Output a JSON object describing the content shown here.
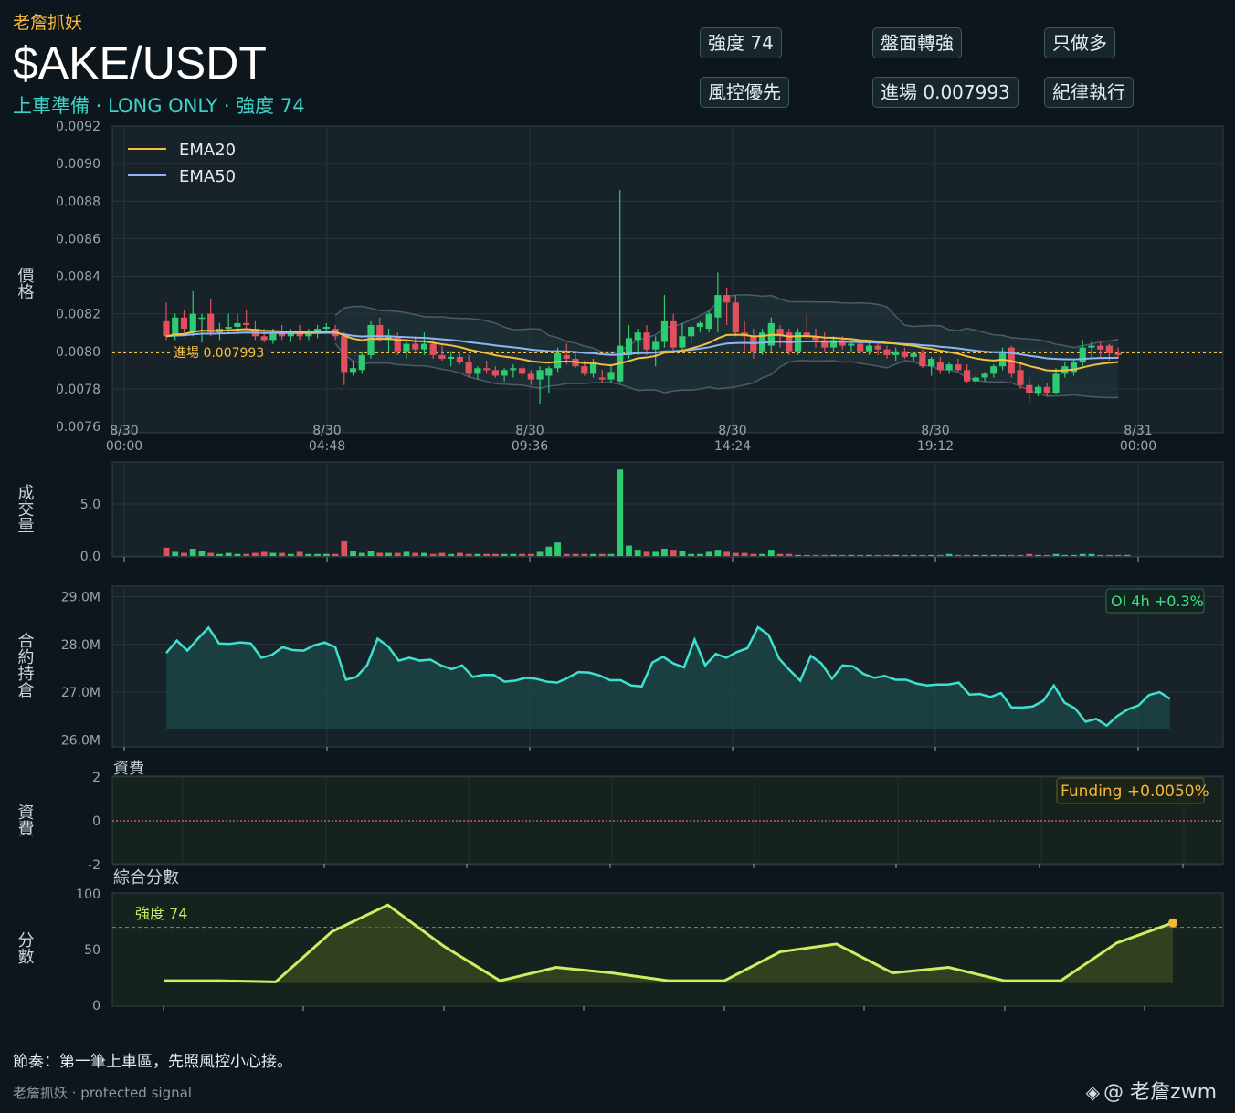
{
  "header": {
    "brand": "老詹抓妖",
    "pair": "$AKE/USDT",
    "subtitle": "上車準備 · LONG ONLY · 強度 74"
  },
  "tags": [
    {
      "label": "強度 74"
    },
    {
      "label": "盤面轉強"
    },
    {
      "label": "只做多"
    },
    {
      "label": "風控優先"
    },
    {
      "label": "進場 0.007993"
    },
    {
      "label": "紀律執行"
    }
  ],
  "footer": {
    "note": "節奏：第一筆上車區，先照風控小心接。",
    "credit": "老詹抓妖 · protected signal",
    "watermark": "@ 老詹zwm"
  },
  "colors": {
    "background": "#0d161c",
    "panel": "#172329",
    "up": "#2ecc71",
    "down": "#e0515d",
    "ema20": "#f0c040",
    "ema50": "#8fb5f5",
    "oi": "#3ee0d0",
    "score": "#c8f060",
    "entry": "#f5c542",
    "funding": "#f5b73a"
  },
  "chart_data": [
    {
      "type": "candlestick",
      "ylabel": "價格",
      "ylim": [
        0.0076,
        0.0092
      ],
      "yticks": [
        "0.0076",
        "0.0078",
        "0.0080",
        "0.0082",
        "0.0084",
        "0.0086",
        "0.0088",
        "0.0090",
        "0.0092"
      ],
      "xticks": [
        "8/30\n00:00",
        "8/30\n04:48",
        "8/30\n09:36",
        "8/30\n14:24",
        "8/30\n19:12",
        "8/31\n00:00"
      ],
      "legend": {
        "position": "top-left",
        "entries": [
          "EMA20",
          "EMA50"
        ]
      },
      "entry_line": {
        "value": 0.007993,
        "label": "進場 0.007993"
      },
      "ohlc": [
        [
          0.00816,
          0.00826,
          0.00806,
          0.00808
        ],
        [
          0.00808,
          0.0082,
          0.00806,
          0.00818
        ],
        [
          0.00818,
          0.00822,
          0.0081,
          0.00812
        ],
        [
          0.0081,
          0.00832,
          0.00808,
          0.0082
        ],
        [
          0.00818,
          0.0082,
          0.00804,
          0.00818
        ],
        [
          0.0082,
          0.00828,
          0.00808,
          0.0081
        ],
        [
          0.0081,
          0.00815,
          0.00806,
          0.00812
        ],
        [
          0.00812,
          0.0082,
          0.0081,
          0.00813
        ],
        [
          0.00813,
          0.0082,
          0.0081,
          0.00815
        ],
        [
          0.00815,
          0.00822,
          0.00812,
          0.00814
        ],
        [
          0.00812,
          0.00816,
          0.00806,
          0.00808
        ],
        [
          0.00808,
          0.00812,
          0.00804,
          0.00806
        ],
        [
          0.00806,
          0.00812,
          0.00804,
          0.0081
        ],
        [
          0.0081,
          0.00814,
          0.00806,
          0.00808
        ],
        [
          0.00808,
          0.00812,
          0.00805,
          0.0081
        ],
        [
          0.0081,
          0.00814,
          0.00806,
          0.00808
        ],
        [
          0.00808,
          0.00812,
          0.00806,
          0.0081
        ],
        [
          0.0081,
          0.00814,
          0.00807,
          0.00812
        ],
        [
          0.00812,
          0.00815,
          0.0081,
          0.00813
        ],
        [
          0.00812,
          0.00814,
          0.00806,
          0.00808
        ],
        [
          0.00808,
          0.0081,
          0.00782,
          0.00789
        ],
        [
          0.00789,
          0.00795,
          0.00787,
          0.00791
        ],
        [
          0.0079,
          0.008,
          0.00788,
          0.00798
        ],
        [
          0.00798,
          0.00816,
          0.00796,
          0.00814
        ],
        [
          0.00814,
          0.00818,
          0.00805,
          0.00806
        ],
        [
          0.00806,
          0.00812,
          0.008,
          0.00808
        ],
        [
          0.00808,
          0.0081,
          0.00798,
          0.008
        ],
        [
          0.008,
          0.00806,
          0.00796,
          0.00804
        ],
        [
          0.00804,
          0.00808,
          0.008,
          0.00801
        ],
        [
          0.00801,
          0.0081,
          0.00798,
          0.00804
        ],
        [
          0.00804,
          0.00806,
          0.00796,
          0.00798
        ],
        [
          0.00798,
          0.00803,
          0.00795,
          0.00796
        ],
        [
          0.00796,
          0.008,
          0.00792,
          0.00797
        ],
        [
          0.00797,
          0.008,
          0.00793,
          0.00794
        ],
        [
          0.00794,
          0.00798,
          0.00786,
          0.00788
        ],
        [
          0.00788,
          0.00792,
          0.00785,
          0.00791
        ],
        [
          0.00791,
          0.00795,
          0.00788,
          0.0079
        ],
        [
          0.0079,
          0.00792,
          0.00786,
          0.00787
        ],
        [
          0.00787,
          0.00791,
          0.00784,
          0.0079
        ],
        [
          0.0079,
          0.00793,
          0.00786,
          0.00791
        ],
        [
          0.00791,
          0.00793,
          0.00786,
          0.00788
        ],
        [
          0.00788,
          0.0079,
          0.00782,
          0.00785
        ],
        [
          0.00785,
          0.00792,
          0.00772,
          0.0079
        ],
        [
          0.00787,
          0.00792,
          0.00778,
          0.00791
        ],
        [
          0.00791,
          0.00802,
          0.00789,
          0.00799
        ],
        [
          0.00798,
          0.00804,
          0.00793,
          0.00796
        ],
        [
          0.00796,
          0.00799,
          0.00791,
          0.00792
        ],
        [
          0.00792,
          0.00795,
          0.00787,
          0.00788
        ],
        [
          0.00788,
          0.00796,
          0.00786,
          0.00794
        ],
        [
          0.00786,
          0.0079,
          0.00783,
          0.00785
        ],
        [
          0.00785,
          0.00792,
          0.00783,
          0.00789
        ],
        [
          0.00784,
          0.00886,
          0.00783,
          0.00803
        ],
        [
          0.00798,
          0.00814,
          0.00796,
          0.00807
        ],
        [
          0.00806,
          0.00812,
          0.00798,
          0.0081
        ],
        [
          0.0081,
          0.00814,
          0.00798,
          0.00801
        ],
        [
          0.00801,
          0.00808,
          0.00792,
          0.00805
        ],
        [
          0.00805,
          0.0083,
          0.00802,
          0.00816
        ],
        [
          0.00816,
          0.0082,
          0.008,
          0.00802
        ],
        [
          0.00802,
          0.00815,
          0.008,
          0.00808
        ],
        [
          0.00808,
          0.00814,
          0.00804,
          0.00813
        ],
        [
          0.00813,
          0.00816,
          0.0081,
          0.00815
        ],
        [
          0.00812,
          0.00822,
          0.0081,
          0.0082
        ],
        [
          0.00818,
          0.00842,
          0.0081,
          0.0083
        ],
        [
          0.0083,
          0.00834,
          0.00814,
          0.00826
        ],
        [
          0.00826,
          0.0083,
          0.00808,
          0.0081
        ],
        [
          0.0081,
          0.00816,
          0.008,
          0.00808
        ],
        [
          0.00808,
          0.00812,
          0.00796,
          0.008
        ],
        [
          0.008,
          0.00812,
          0.00798,
          0.0081
        ],
        [
          0.00803,
          0.00818,
          0.008,
          0.00815
        ],
        [
          0.00812,
          0.00814,
          0.00802,
          0.00808
        ],
        [
          0.0081,
          0.00812,
          0.00798,
          0.008
        ],
        [
          0.008,
          0.00812,
          0.00798,
          0.0081
        ],
        [
          0.0081,
          0.0082,
          0.00806,
          0.00808
        ],
        [
          0.00808,
          0.00812,
          0.00802,
          0.00806
        ],
        [
          0.00806,
          0.0081,
          0.008,
          0.00802
        ],
        [
          0.00802,
          0.00808,
          0.008,
          0.00806
        ],
        [
          0.00806,
          0.00808,
          0.00801,
          0.00803
        ],
        [
          0.00803,
          0.00806,
          0.008,
          0.00804
        ],
        [
          0.00804,
          0.00806,
          0.00799,
          0.008
        ],
        [
          0.008,
          0.00805,
          0.00798,
          0.00803
        ],
        [
          0.00803,
          0.00805,
          0.00798,
          0.00801
        ],
        [
          0.00801,
          0.00803,
          0.00796,
          0.00798
        ],
        [
          0.00798,
          0.00802,
          0.00795,
          0.008
        ],
        [
          0.008,
          0.00802,
          0.00796,
          0.00797
        ],
        [
          0.00797,
          0.008,
          0.00794,
          0.00799
        ],
        [
          0.00799,
          0.00801,
          0.00791,
          0.00792
        ],
        [
          0.00792,
          0.00797,
          0.00787,
          0.00796
        ],
        [
          0.00794,
          0.00797,
          0.00788,
          0.0079
        ],
        [
          0.0079,
          0.00794,
          0.00788,
          0.00793
        ],
        [
          0.00793,
          0.00796,
          0.00789,
          0.0079
        ],
        [
          0.0079,
          0.00793,
          0.00783,
          0.00784
        ],
        [
          0.00784,
          0.00787,
          0.00782,
          0.00786
        ],
        [
          0.00786,
          0.00789,
          0.00784,
          0.00788
        ],
        [
          0.00788,
          0.00793,
          0.00786,
          0.00792
        ],
        [
          0.00792,
          0.00802,
          0.0079,
          0.008
        ],
        [
          0.00802,
          0.00803,
          0.00786,
          0.00788
        ],
        [
          0.0079,
          0.00794,
          0.0078,
          0.00782
        ],
        [
          0.00782,
          0.00786,
          0.00773,
          0.00778
        ],
        [
          0.00778,
          0.00782,
          0.00776,
          0.00781
        ],
        [
          0.00781,
          0.00783,
          0.00776,
          0.00778
        ],
        [
          0.00778,
          0.00791,
          0.00777,
          0.00788
        ],
        [
          0.00788,
          0.00794,
          0.00786,
          0.00792
        ],
        [
          0.00789,
          0.00796,
          0.00787,
          0.00794
        ],
        [
          0.00794,
          0.00806,
          0.00792,
          0.00802
        ],
        [
          0.00802,
          0.00805,
          0.00796,
          0.00803
        ],
        [
          0.00803,
          0.00805,
          0.00797,
          0.00801
        ],
        [
          0.00803,
          0.00804,
          0.00795,
          0.00799
        ],
        [
          0.00799,
          0.00802,
          0.00796,
          0.00798
        ]
      ]
    },
    {
      "type": "bar",
      "ylabel": "成交量",
      "yticks": [
        "0.0",
        "5.0"
      ],
      "values": [
        0.8,
        0.4,
        0.3,
        0.7,
        0.5,
        0.3,
        0.2,
        0.3,
        0.2,
        0.2,
        0.3,
        0.4,
        0.3,
        0.3,
        0.2,
        0.4,
        0.2,
        0.2,
        0.2,
        0.2,
        1.5,
        0.5,
        0.3,
        0.5,
        0.3,
        0.3,
        0.3,
        0.4,
        0.3,
        0.3,
        0.2,
        0.3,
        0.2,
        0.3,
        0.2,
        0.2,
        0.2,
        0.2,
        0.2,
        0.2,
        0.2,
        0.2,
        0.4,
        0.9,
        1.3,
        0.2,
        0.2,
        0.2,
        0.2,
        0.2,
        0.2,
        8.3,
        1.0,
        0.6,
        0.4,
        0.4,
        0.7,
        0.6,
        0.5,
        0.2,
        0.2,
        0.4,
        0.6,
        0.4,
        0.3,
        0.3,
        0.2,
        0.2,
        0.6,
        0.2,
        0.2,
        0.1,
        0.1,
        0.1,
        0.1,
        0.1,
        0.1,
        0.1,
        0.1,
        0.1,
        0.1,
        0.1,
        0.1,
        0.1,
        0.1,
        0.1,
        0.1,
        0.1,
        0.2,
        0.1,
        0.1,
        0.1,
        0.1,
        0.1,
        0.1,
        0.1,
        0.1,
        0.2,
        0.1,
        0.1,
        0.2,
        0.1,
        0.1,
        0.2,
        0.2,
        0.1,
        0.1,
        0.1,
        0.1
      ],
      "ylim": [
        0,
        8.5
      ]
    },
    {
      "type": "area",
      "ylabel": "合約持倉",
      "yticks": [
        "26.0M",
        "27.0M",
        "28.0M",
        "29.0M"
      ],
      "ylim": [
        25.95,
        29.2
      ],
      "annotation": "OI 4h +0.3%",
      "values": [
        27.82,
        28.08,
        27.87,
        28.12,
        28.35,
        28.02,
        28.01,
        28.04,
        28.02,
        27.72,
        27.78,
        27.94,
        27.88,
        27.87,
        27.98,
        28.04,
        27.94,
        27.26,
        27.32,
        27.56,
        28.12,
        27.96,
        27.66,
        27.72,
        27.66,
        27.68,
        27.56,
        27.48,
        27.56,
        27.32,
        27.36,
        27.36,
        27.22,
        27.24,
        27.3,
        27.28,
        27.22,
        27.2,
        27.3,
        27.42,
        27.41,
        27.35,
        27.25,
        27.25,
        27.14,
        27.12,
        27.62,
        27.74,
        27.6,
        27.52,
        28.1,
        27.56,
        27.8,
        27.72,
        27.84,
        27.92,
        28.36,
        28.2,
        27.7,
        27.46,
        27.24,
        27.76,
        27.6,
        27.28,
        27.56,
        27.54,
        27.38,
        27.3,
        27.34,
        27.26,
        27.26,
        27.18,
        27.14,
        27.16,
        27.16,
        27.2,
        26.95,
        26.96,
        26.9,
        26.98,
        26.68,
        26.68,
        26.7,
        26.82,
        27.14,
        26.78,
        26.66,
        26.38,
        26.44,
        26.3,
        26.5,
        26.64,
        26.72,
        26.94,
        27.0,
        26.86
      ]
    },
    {
      "type": "line",
      "title": "資費",
      "ylabel": "資費",
      "yticks": [
        "-2",
        "0",
        "2"
      ],
      "ylim": [
        -2,
        2
      ],
      "annotation": "Funding +0.0050%",
      "values": [
        0,
        0
      ]
    },
    {
      "type": "area",
      "title": "綜合分數",
      "ylabel": "分數",
      "yticks": [
        "0",
        "50",
        "100"
      ],
      "ylim": [
        0,
        100
      ],
      "annotation": "強度 74",
      "threshold": 70,
      "values": [
        22,
        22,
        21,
        66,
        90,
        53,
        22,
        34,
        29,
        22,
        22,
        48,
        55,
        29,
        34,
        22,
        22,
        56,
        74
      ]
    }
  ]
}
